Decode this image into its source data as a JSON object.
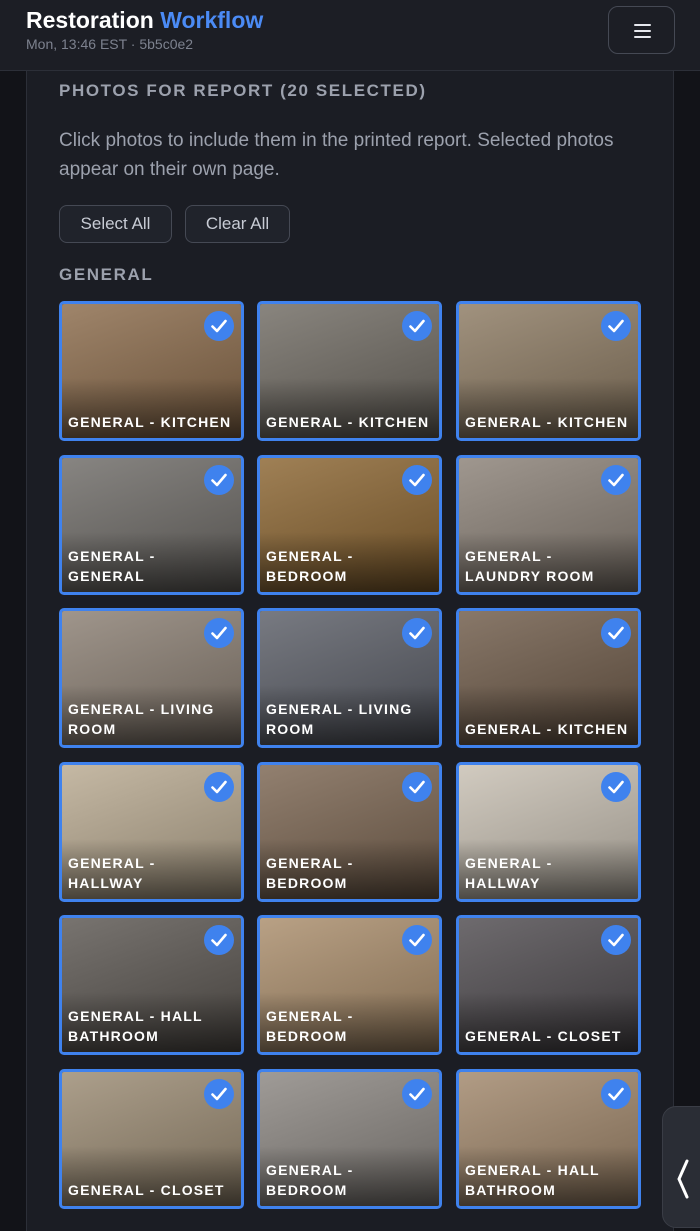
{
  "header": {
    "title_main": "Restoration",
    "title_accent": "Workflow",
    "subtitle": "Mon, 13:46 EST · 5b5c0e2"
  },
  "section": {
    "title": "PHOTOS FOR REPORT (20 SELECTED)",
    "description": "Click photos to include them in the printed report. Selected photos appear on their own page.",
    "select_all": "Select All",
    "clear_all": "Clear All",
    "group": "GENERAL"
  },
  "photos": [
    {
      "label": "GENERAL - KITCHEN",
      "selected": true,
      "bg": "#8a6a4a"
    },
    {
      "label": "GENERAL - KITCHEN",
      "selected": true,
      "bg": "#6f6a62"
    },
    {
      "label": "GENERAL - KITCHEN",
      "selected": true,
      "bg": "#8c7a62"
    },
    {
      "label": "GENERAL - GENERAL",
      "selected": true,
      "bg": "#6d6a66"
    },
    {
      "label": "GENERAL - BEDROOM",
      "selected": true,
      "bg": "#8a6430"
    },
    {
      "label": "GENERAL - LAUNDRY ROOM",
      "selected": true,
      "bg": "#8a8076"
    },
    {
      "label": "GENERAL - LIVING ROOM",
      "selected": true,
      "bg": "#8a7e72"
    },
    {
      "label": "GENERAL - LIVING ROOM",
      "selected": true,
      "bg": "#5a5d66"
    },
    {
      "label": "GENERAL - KITCHEN",
      "selected": true,
      "bg": "#6e5a48"
    },
    {
      "label": "GENERAL - HALLWAY",
      "selected": true,
      "bg": "#b8a990"
    },
    {
      "label": "GENERAL - BEDROOM",
      "selected": true,
      "bg": "#7a6450"
    },
    {
      "label": "GENERAL - HALLWAY",
      "selected": true,
      "bg": "#c7bfb2"
    },
    {
      "label": "GENERAL - HALL BATHROOM",
      "selected": true,
      "bg": "#5a5550"
    },
    {
      "label": "GENERAL - BEDROOM",
      "selected": true,
      "bg": "#a98c6a"
    },
    {
      "label": "GENERAL - CLOSET",
      "selected": true,
      "bg": "#4e4a4e"
    },
    {
      "label": "GENERAL - CLOSET",
      "selected": true,
      "bg": "#9a8a72"
    },
    {
      "label": "GENERAL - BEDROOM",
      "selected": true,
      "bg": "#8a8580"
    },
    {
      "label": "GENERAL - HALL BATHROOM",
      "selected": true,
      "bg": "#a0866a"
    }
  ]
}
